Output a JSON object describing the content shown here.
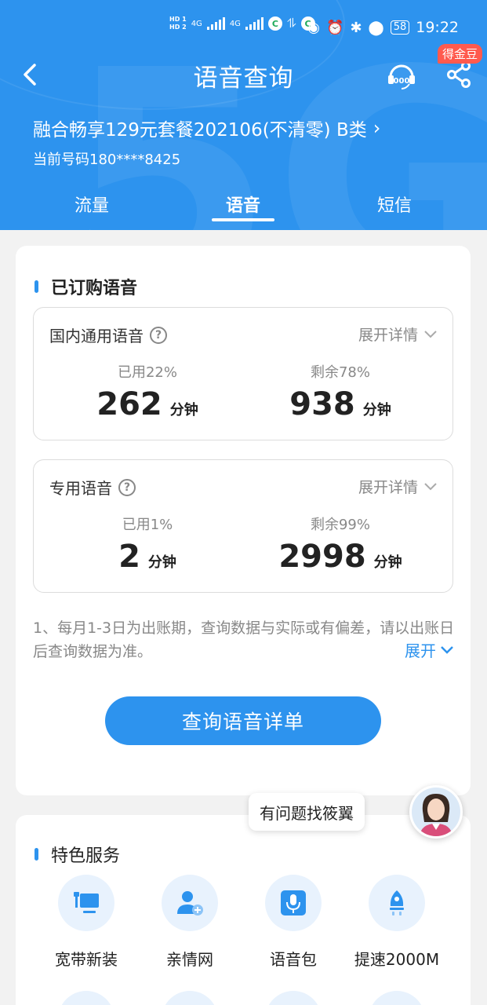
{
  "status_bar": {
    "hd1": "HD 1",
    "hd2": "HD 2",
    "net1": "4G",
    "net2": "4G",
    "battery": "58",
    "time": "19:22"
  },
  "header": {
    "title": "语音查询",
    "badge": "得金豆",
    "plan_name": "融合畅享129元套餐202106(不清零) B类",
    "phone_label": "当前号码180****8425",
    "tabs": [
      {
        "label": "流量"
      },
      {
        "label": "语音"
      },
      {
        "label": "短信"
      }
    ],
    "active_tab": 1
  },
  "colors": {
    "primary": "#2d93ee",
    "badge": "#ff5a4e"
  },
  "subscribed": {
    "title": "已订购语音",
    "packages": [
      {
        "name": "国内通用语音",
        "expand": "展开详情",
        "used_label": "已用22%",
        "used_value": "262",
        "remain_label": "剩余78%",
        "remain_value": "938",
        "unit": "分钟"
      },
      {
        "name": "专用语音",
        "expand": "展开详情",
        "used_label": "已用1%",
        "used_value": "2",
        "remain_label": "剩余99%",
        "remain_value": "2998",
        "unit": "分钟"
      }
    ],
    "note": "1、每月1-3日为出账期，查询数据与实际或有偏差，请以出账日后查询数据为准。",
    "note_expand": "展开",
    "query_button": "查询语音详单"
  },
  "assistant": {
    "bubble": "有问题找筱翼"
  },
  "features": {
    "title": "特色服务",
    "items": [
      {
        "label": "宽带新装",
        "icon": "broadband-icon"
      },
      {
        "label": "亲情网",
        "icon": "family-icon"
      },
      {
        "label": "语音包",
        "icon": "microphone-icon"
      },
      {
        "label": "提速2000M",
        "icon": "rocket-icon"
      }
    ]
  }
}
